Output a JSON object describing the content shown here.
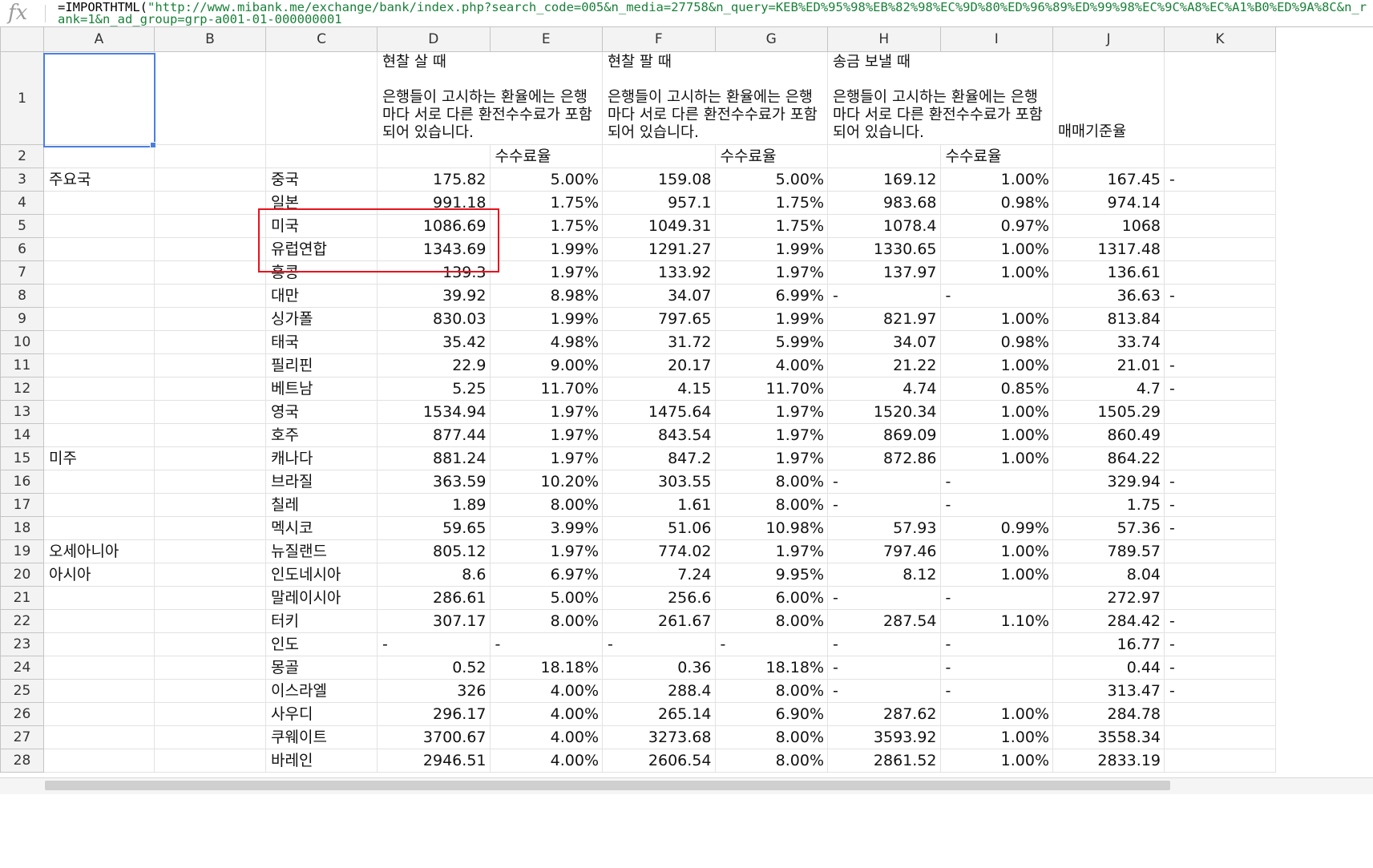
{
  "formula_bar": {
    "icon": "fx-icon",
    "prefix": "=IMPORTHTML(",
    "url": "\"http://www.mibank.me/exchange/bank/index.php?search_code=005&n_media=27758&n_query=KEB%ED%95%98%EB%82%98%EC%9D%80%ED%96%89%ED%99%98%EC%9C%A8%EC%A1%B0%ED%9A%8C&n_rank=1&n_ad_group=grp-a001-01-000000001"
  },
  "columns": [
    "A",
    "B",
    "C",
    "D",
    "E",
    "F",
    "G",
    "H",
    "I",
    "J",
    "K"
  ],
  "header_row": {
    "D": {
      "title": "현찰 살 때",
      "note": "은행들이 고시하는 환율에는 은행마다 서로 다른 환전수수료가 포함되어 있습니다."
    },
    "F": {
      "title": "현찰 팔 때",
      "note": "은행들이 고시하는 환율에는 은행마다 서로 다른 환전수수료가 포함되어 있습니다."
    },
    "H": {
      "title": "송금 보낼 때",
      "note": "은행들이 고시하는 환율에는 은행마다 서로 다른 환전수수료가 포함되어 있습니다."
    },
    "J": "매매기준율"
  },
  "row2": {
    "E": "수수료율",
    "G": "수수료율",
    "I": "수수료율"
  },
  "rows": [
    {
      "n": "3",
      "A": "주요국",
      "C": "중국",
      "D": "175.82",
      "E": "5.00%",
      "F": "159.08",
      "G": "5.00%",
      "H": "169.12",
      "I": "1.00%",
      "J": "167.45",
      "K": "-"
    },
    {
      "n": "4",
      "A": "",
      "C": "일본",
      "D": "991.18",
      "E": "1.75%",
      "F": "957.1",
      "G": "1.75%",
      "H": "983.68",
      "I": "0.98%",
      "J": "974.14",
      "K": ""
    },
    {
      "n": "5",
      "A": "",
      "C": "미국",
      "D": "1086.69",
      "E": "1.75%",
      "F": "1049.31",
      "G": "1.75%",
      "H": "1078.4",
      "I": "0.97%",
      "J": "1068",
      "K": ""
    },
    {
      "n": "6",
      "A": "",
      "C": "유럽연합",
      "D": "1343.69",
      "E": "1.99%",
      "F": "1291.27",
      "G": "1.99%",
      "H": "1330.65",
      "I": "1.00%",
      "J": "1317.48",
      "K": ""
    },
    {
      "n": "7",
      "A": "",
      "C": "홍콩",
      "D": "139.3",
      "E": "1.97%",
      "F": "133.92",
      "G": "1.97%",
      "H": "137.97",
      "I": "1.00%",
      "J": "136.61",
      "K": ""
    },
    {
      "n": "8",
      "A": "",
      "C": "대만",
      "D": "39.92",
      "E": "8.98%",
      "F": "34.07",
      "G": "6.99%",
      "H": "-",
      "I": "-",
      "J": "36.63",
      "K": "-"
    },
    {
      "n": "9",
      "A": "",
      "C": "싱가폴",
      "D": "830.03",
      "E": "1.99%",
      "F": "797.65",
      "G": "1.99%",
      "H": "821.97",
      "I": "1.00%",
      "J": "813.84",
      "K": ""
    },
    {
      "n": "10",
      "A": "",
      "C": "태국",
      "D": "35.42",
      "E": "4.98%",
      "F": "31.72",
      "G": "5.99%",
      "H": "34.07",
      "I": "0.98%",
      "J": "33.74",
      "K": ""
    },
    {
      "n": "11",
      "A": "",
      "C": "필리핀",
      "D": "22.9",
      "E": "9.00%",
      "F": "20.17",
      "G": "4.00%",
      "H": "21.22",
      "I": "1.00%",
      "J": "21.01",
      "K": "-"
    },
    {
      "n": "12",
      "A": "",
      "C": "베트남",
      "D": "5.25",
      "E": "11.70%",
      "F": "4.15",
      "G": "11.70%",
      "H": "4.74",
      "I": "0.85%",
      "J": "4.7",
      "K": "-"
    },
    {
      "n": "13",
      "A": "",
      "C": "영국",
      "D": "1534.94",
      "E": "1.97%",
      "F": "1475.64",
      "G": "1.97%",
      "H": "1520.34",
      "I": "1.00%",
      "J": "1505.29",
      "K": ""
    },
    {
      "n": "14",
      "A": "",
      "C": "호주",
      "D": "877.44",
      "E": "1.97%",
      "F": "843.54",
      "G": "1.97%",
      "H": "869.09",
      "I": "1.00%",
      "J": "860.49",
      "K": ""
    },
    {
      "n": "15",
      "A": "미주",
      "C": "캐나다",
      "D": "881.24",
      "E": "1.97%",
      "F": "847.2",
      "G": "1.97%",
      "H": "872.86",
      "I": "1.00%",
      "J": "864.22",
      "K": ""
    },
    {
      "n": "16",
      "A": "",
      "C": "브라질",
      "D": "363.59",
      "E": "10.20%",
      "F": "303.55",
      "G": "8.00%",
      "H": "-",
      "I": "-",
      "J": "329.94",
      "K": "-"
    },
    {
      "n": "17",
      "A": "",
      "C": "칠레",
      "D": "1.89",
      "E": "8.00%",
      "F": "1.61",
      "G": "8.00%",
      "H": "-",
      "I": "-",
      "J": "1.75",
      "K": "-"
    },
    {
      "n": "18",
      "A": "",
      "C": "멕시코",
      "D": "59.65",
      "E": "3.99%",
      "F": "51.06",
      "G": "10.98%",
      "H": "57.93",
      "I": "0.99%",
      "J": "57.36",
      "K": "-"
    },
    {
      "n": "19",
      "A": "오세아니아",
      "C": "뉴질랜드",
      "D": "805.12",
      "E": "1.97%",
      "F": "774.02",
      "G": "1.97%",
      "H": "797.46",
      "I": "1.00%",
      "J": "789.57",
      "K": ""
    },
    {
      "n": "20",
      "A": "아시아",
      "C": "인도네시아",
      "D": "8.6",
      "E": "6.97%",
      "F": "7.24",
      "G": "9.95%",
      "H": "8.12",
      "I": "1.00%",
      "J": "8.04",
      "K": ""
    },
    {
      "n": "21",
      "A": "",
      "C": "말레이시아",
      "D": "286.61",
      "E": "5.00%",
      "F": "256.6",
      "G": "6.00%",
      "H": "-",
      "I": "-",
      "J": "272.97",
      "K": ""
    },
    {
      "n": "22",
      "A": "",
      "C": "터키",
      "D": "307.17",
      "E": "8.00%",
      "F": "261.67",
      "G": "8.00%",
      "H": "287.54",
      "I": "1.10%",
      "J": "284.42",
      "K": "-"
    },
    {
      "n": "23",
      "A": "",
      "C": "인도",
      "D": "-",
      "E": "-",
      "F": "-",
      "G": "-",
      "H": "-",
      "I": "-",
      "J": "16.77",
      "K": "-"
    },
    {
      "n": "24",
      "A": "",
      "C": "몽골",
      "D": "0.52",
      "E": "18.18%",
      "F": "0.36",
      "G": "18.18%",
      "H": "-",
      "I": "-",
      "J": "0.44",
      "K": "-"
    },
    {
      "n": "25",
      "A": "",
      "C": "이스라엘",
      "D": "326",
      "E": "4.00%",
      "F": "288.4",
      "G": "8.00%",
      "H": "-",
      "I": "-",
      "J": "313.47",
      "K": "-"
    },
    {
      "n": "26",
      "A": "",
      "C": "사우디",
      "D": "296.17",
      "E": "4.00%",
      "F": "265.14",
      "G": "6.90%",
      "H": "287.62",
      "I": "1.00%",
      "J": "284.78",
      "K": ""
    },
    {
      "n": "27",
      "A": "",
      "C": "쿠웨이트",
      "D": "3700.67",
      "E": "4.00%",
      "F": "3273.68",
      "G": "8.00%",
      "H": "3593.92",
      "I": "1.00%",
      "J": "3558.34",
      "K": ""
    },
    {
      "n": "28",
      "A": "",
      "C": "바레인",
      "D": "2946.51",
      "E": "4.00%",
      "F": "2606.54",
      "G": "8.00%",
      "H": "2861.52",
      "I": "1.00%",
      "J": "2833.19",
      "K": ""
    }
  ]
}
